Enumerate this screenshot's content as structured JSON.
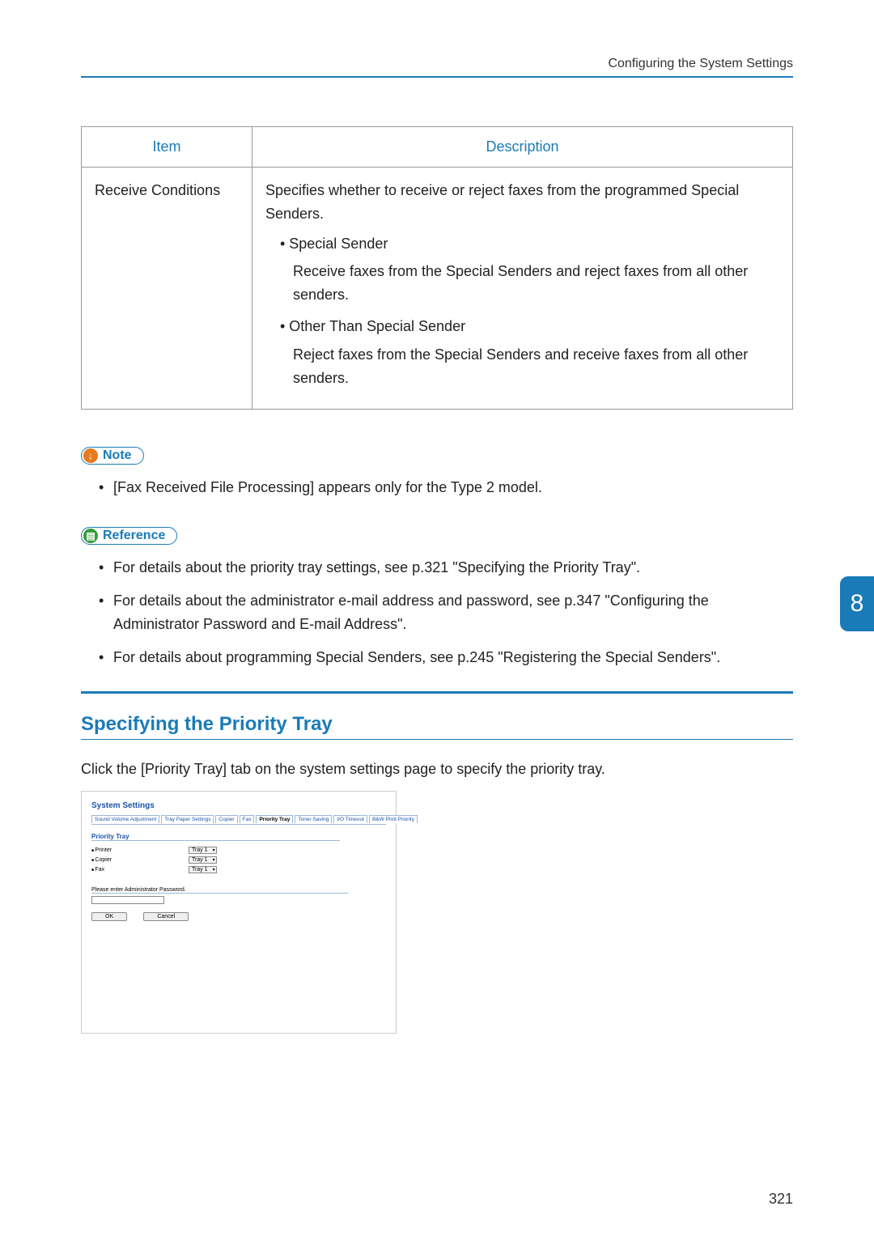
{
  "header": {
    "title": "Configuring the System Settings"
  },
  "table": {
    "headers": {
      "item": "Item",
      "description": "Description"
    },
    "row": {
      "item": "Receive Conditions",
      "intro": "Specifies whether to receive or reject faxes from the programmed Special Senders.",
      "bullets": [
        {
          "title": "Special Sender",
          "text": "Receive faxes from the Special Senders and reject faxes from all other senders."
        },
        {
          "title": "Other Than Special Sender",
          "text": "Reject faxes from the Special Senders and receive faxes from all other senders."
        }
      ]
    }
  },
  "note": {
    "label": "Note",
    "items": [
      "[Fax Received File Processing] appears only for the Type 2 model."
    ]
  },
  "reference": {
    "label": "Reference",
    "items": [
      "For details about the priority tray settings, see p.321 \"Specifying the Priority Tray\".",
      "For details about the administrator e-mail address and password, see p.347 \"Configuring the Administrator Password and E-mail Address\".",
      "For details about programming Special Senders, see p.245 \"Registering the Special Senders\"."
    ]
  },
  "section": {
    "heading": "Specifying the Priority Tray",
    "body": "Click the [Priority Tray] tab on the system settings page to specify the priority tray."
  },
  "screenshot": {
    "title": "System Settings",
    "tabs": [
      "Sound Volume Adjustment",
      "Tray Paper Settings",
      "Copier",
      "Fax",
      "Priority Tray",
      "Toner Saving",
      "I/O Timeout",
      "B&W Print Priority"
    ],
    "activeTabIndex": 4,
    "groupTitle": "Priority Tray",
    "rows": [
      {
        "label": "Printer",
        "value": "Tray 1"
      },
      {
        "label": "Copier",
        "value": "Tray 1"
      },
      {
        "label": "Fax",
        "value": "Tray 1"
      }
    ],
    "pwdLabel": "Please enter Administrator Password.",
    "buttons": {
      "ok": "OK",
      "cancel": "Cancel"
    }
  },
  "chapter": "8",
  "pageNumber": "321"
}
